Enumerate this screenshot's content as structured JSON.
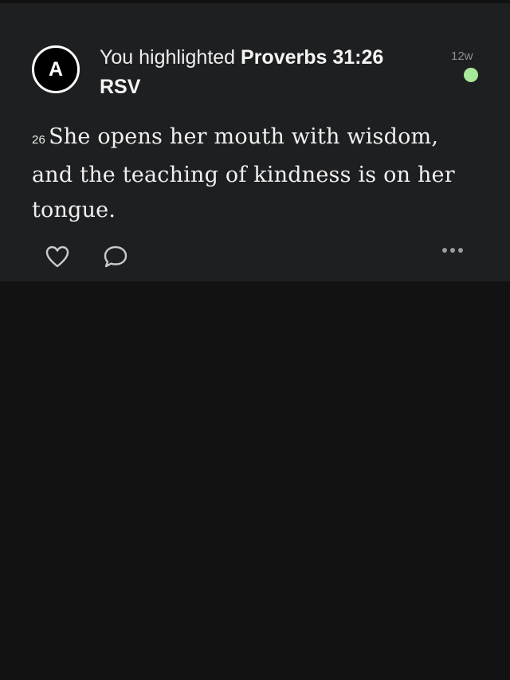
{
  "notification": {
    "avatar_initial": "A",
    "headline_prefix": "You highlighted",
    "reference": "Proverbs 31:26",
    "version": "RSV",
    "timestamp": "12w",
    "status_color": "#a7e89a"
  },
  "verse": {
    "number": "26",
    "text": "She opens her mouth with wisdom, and the teaching of kindness is on her tongue."
  },
  "actions": {
    "like_icon": "heart-outline-icon",
    "comment_icon": "speech-bubble-icon",
    "more_icon": "ellipsis-icon"
  }
}
